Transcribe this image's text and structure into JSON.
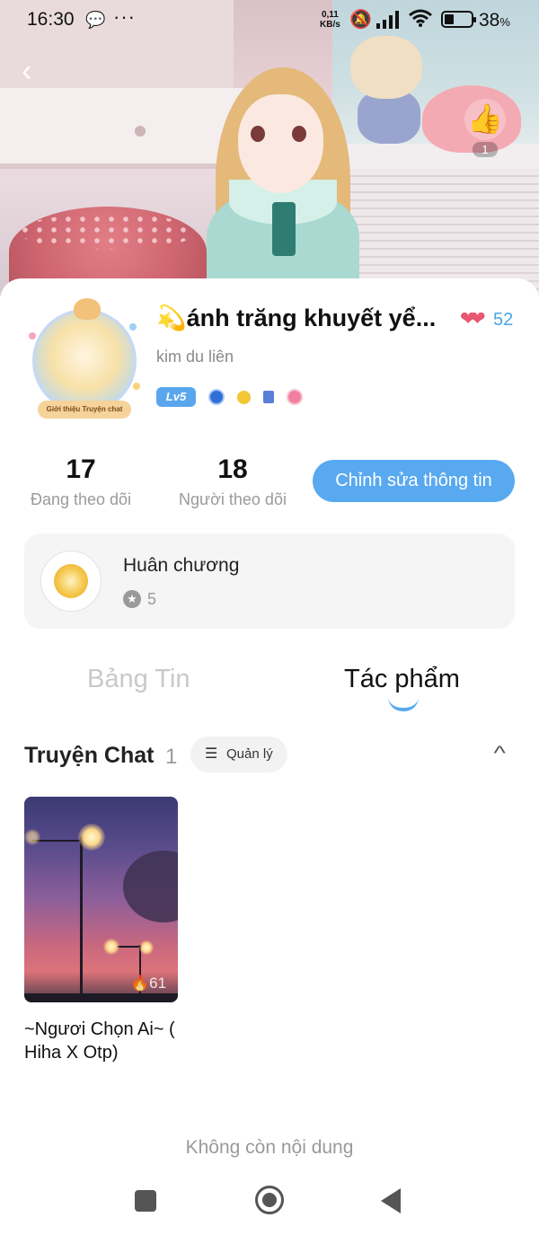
{
  "status_bar": {
    "time": "16:30",
    "net_speed_top": "0,11",
    "net_speed_bottom": "KB/s",
    "battery_pct": "38",
    "battery_unit": "%"
  },
  "header": {
    "like_count": "1"
  },
  "profile": {
    "display_name": "ánh trăng khuyết yể...",
    "name_emoji": "💫",
    "hearts_count": "52",
    "username": "kim du liên",
    "avatar_caption": "Giới thiệu Truyện chat",
    "level_badge": "Lv5"
  },
  "stats": {
    "following_count": "17",
    "following_label": "Đang theo dõi",
    "followers_count": "18",
    "followers_label": "Người theo dõi",
    "edit_button_label": "Chỉnh sửa thông tin"
  },
  "medal": {
    "title": "Huân chương",
    "count": "5"
  },
  "tabs": [
    {
      "label": "Bảng Tin",
      "active": false
    },
    {
      "label": "Tác phẩm",
      "active": true
    }
  ],
  "section": {
    "title": "Truyện Chat",
    "count": "1",
    "manage_label": "Quản lý"
  },
  "stories": [
    {
      "title": "~Ngươi Chọn Ai~ ( Hiha X Otp)",
      "views": "61"
    }
  ],
  "end_message": "Không còn nội dung",
  "colors": {
    "accent": "#58a9ef",
    "heart": "#e85870",
    "muted": "#9a9a9a"
  }
}
